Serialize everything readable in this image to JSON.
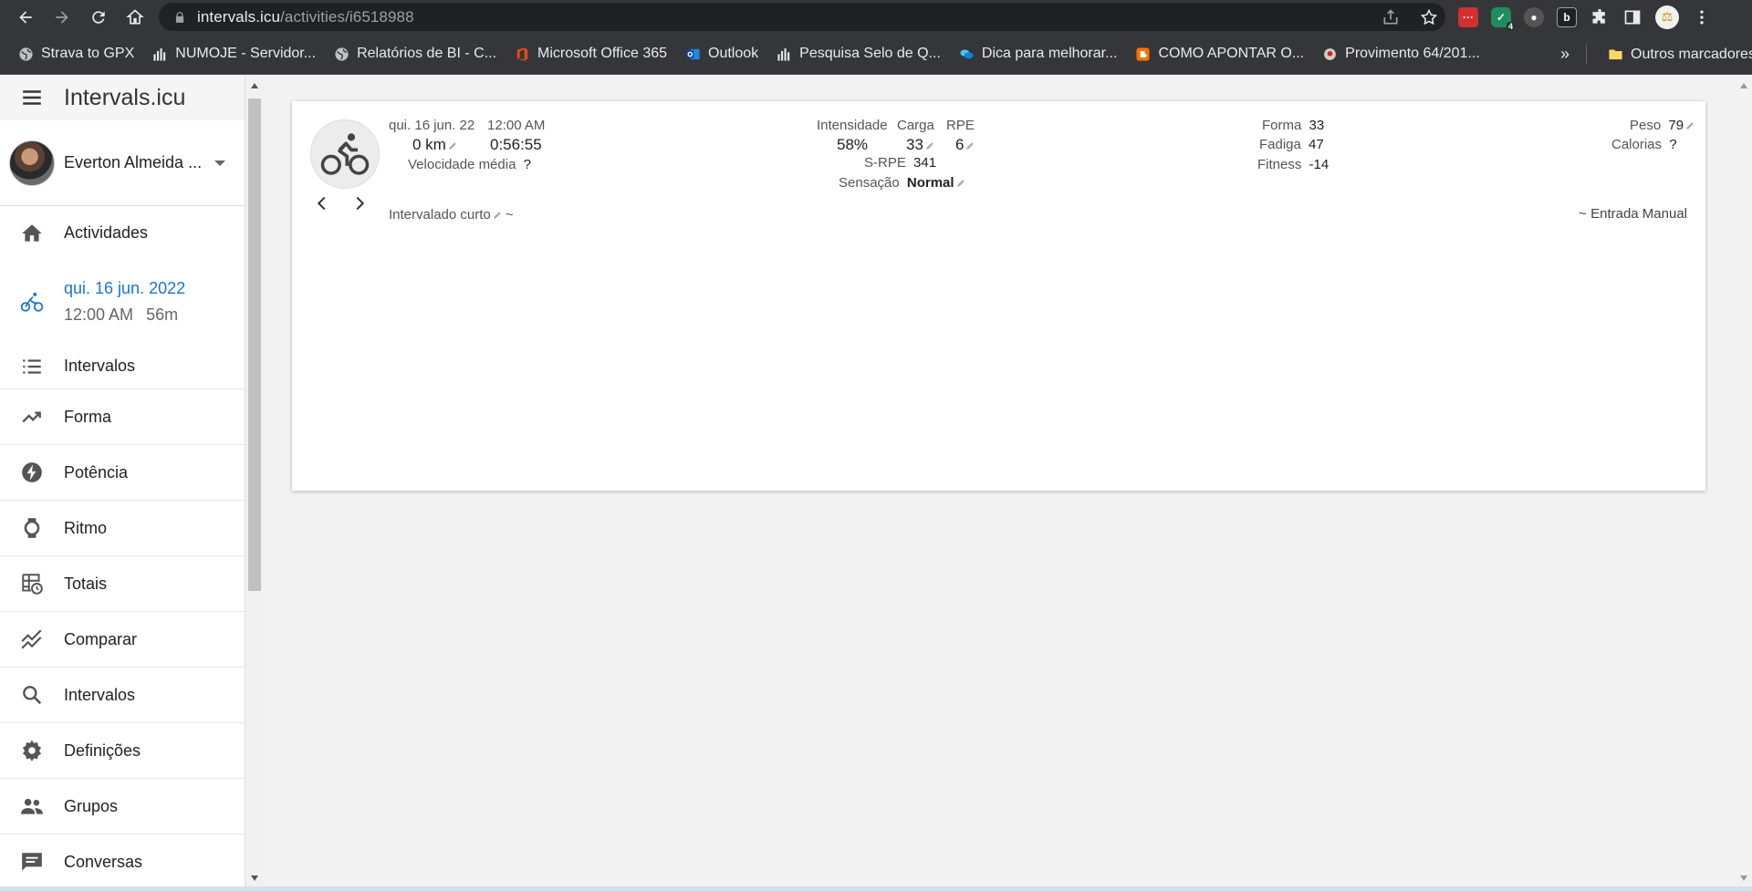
{
  "browser": {
    "url_host": "intervals.icu",
    "url_path": "/activities/i6518988",
    "bookmarks": [
      {
        "label": "Strava to GPX",
        "icon": "globe-icon"
      },
      {
        "label": "NUMOJE - Servidor...",
        "icon": "bars-icon"
      },
      {
        "label": "Relatórios de BI - C...",
        "icon": "globe-icon"
      },
      {
        "label": "Microsoft Office 365",
        "icon": "office-icon"
      },
      {
        "label": "Outlook",
        "icon": "outlook-icon"
      },
      {
        "label": "Pesquisa Selo de Q...",
        "icon": "bars-icon"
      },
      {
        "label": "Dica para melhorar...",
        "icon": "chat-icon"
      },
      {
        "label": "COMO APONTAR O...",
        "icon": "blogger-icon"
      },
      {
        "label": "Provimento 64/201...",
        "icon": "seal-icon"
      }
    ],
    "more_bookmarks": "»",
    "other_bookmarks": "Outros marcadores",
    "extension_badge": "4"
  },
  "sidebar": {
    "app_title": "Intervals.icu",
    "user_name": "Everton Almeida ...",
    "items": [
      {
        "label": "Actividades",
        "icon": "home-icon"
      },
      {
        "label": "Intervalos",
        "icon": "list-icon"
      },
      {
        "label": "Forma",
        "icon": "trending-up-icon"
      },
      {
        "label": "Potência",
        "icon": "bolt-icon"
      },
      {
        "label": "Ritmo",
        "icon": "watch-icon"
      },
      {
        "label": "Totais",
        "icon": "table-clock-icon"
      },
      {
        "label": "Comparar",
        "icon": "compare-chart-icon"
      },
      {
        "label": "Intervalos",
        "icon": "search-icon"
      },
      {
        "label": "Definições",
        "icon": "gear-icon"
      },
      {
        "label": "Grupos",
        "icon": "people-icon"
      },
      {
        "label": "Conversas",
        "icon": "message-icon"
      }
    ],
    "current_activity": {
      "date": "qui. 16 jun. 2022",
      "time": "12:00 AM",
      "duration": "56m"
    }
  },
  "activity": {
    "date_short": "qui. 16 jun. 22",
    "time": "12:00 AM",
    "distance": "0 km",
    "moving_time": "0:56:55",
    "avg_speed_label": "Velocidade média",
    "avg_speed_value": "?",
    "intensity_label": "Intensidade",
    "intensity_value": "58%",
    "load_label": "Carga",
    "load_value": "33",
    "rpe_label": "RPE",
    "rpe_value": "6",
    "srpe_label": "S-RPE",
    "srpe_value": "341",
    "feel_label": "Sensação",
    "feel_value": "Normal",
    "form_label": "Forma",
    "form_value": "33",
    "fatigue_label": "Fadiga",
    "fatigue_value": "47",
    "fitness_label": "Fitness",
    "fitness_value": "-14",
    "weight_label": "Peso",
    "weight_value": "79",
    "calories_label": "Calorias",
    "calories_value": "?",
    "name": "Intervalado curto",
    "name_suffix": "~",
    "source": "~ Entrada Manual"
  }
}
